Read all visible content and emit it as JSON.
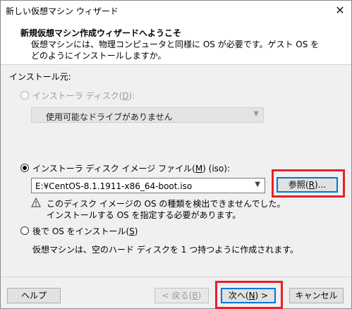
{
  "window": {
    "title": "新しい仮想マシン ウィザード",
    "close_glyph": "✕"
  },
  "header": {
    "title": "新規仮想マシン作成ウィザードへようこそ",
    "description": "仮想マシンには、物理コンピュータと同様に OS が必要です。ゲスト OS をどのようにインストールしますか。"
  },
  "install_source": {
    "label": "インストール元:",
    "disc": {
      "label_pre": "インストーラ ディスク(",
      "label_key": "D",
      "label_post": "):",
      "selected": false,
      "enabled": false,
      "dropdown_value": "使用可能なドライブがありません"
    },
    "iso": {
      "label_pre": "インストーラ ディスク イメージ ファイル(",
      "label_key": "M",
      "label_post": ") (iso):",
      "selected": true,
      "path_value": "E:¥CentOS-8.1.1911-x86_64-boot.iso",
      "browse_pre": "参照(",
      "browse_key": "R",
      "browse_post": ")...",
      "warning_line1": "このディスク イメージの OS の種類を検出できませんでした。",
      "warning_line2": "インストールする OS を指定する必要があります。"
    },
    "later": {
      "label_pre": "後で OS をインストール(",
      "label_key": "S",
      "label_post": ")",
      "selected": false,
      "description": "仮想マシンは、空のハード ディスクを 1 つ持つように作成されます。"
    }
  },
  "footer": {
    "help": "ヘルプ",
    "back_pre": "< 戻る(",
    "back_key": "B",
    "back_post": ")",
    "next_pre": "次へ(",
    "next_key": "N",
    "next_post": ") >",
    "cancel": "キャンセル"
  },
  "colors": {
    "highlight": "#e8202a",
    "focus_blue": "#0078d7"
  }
}
